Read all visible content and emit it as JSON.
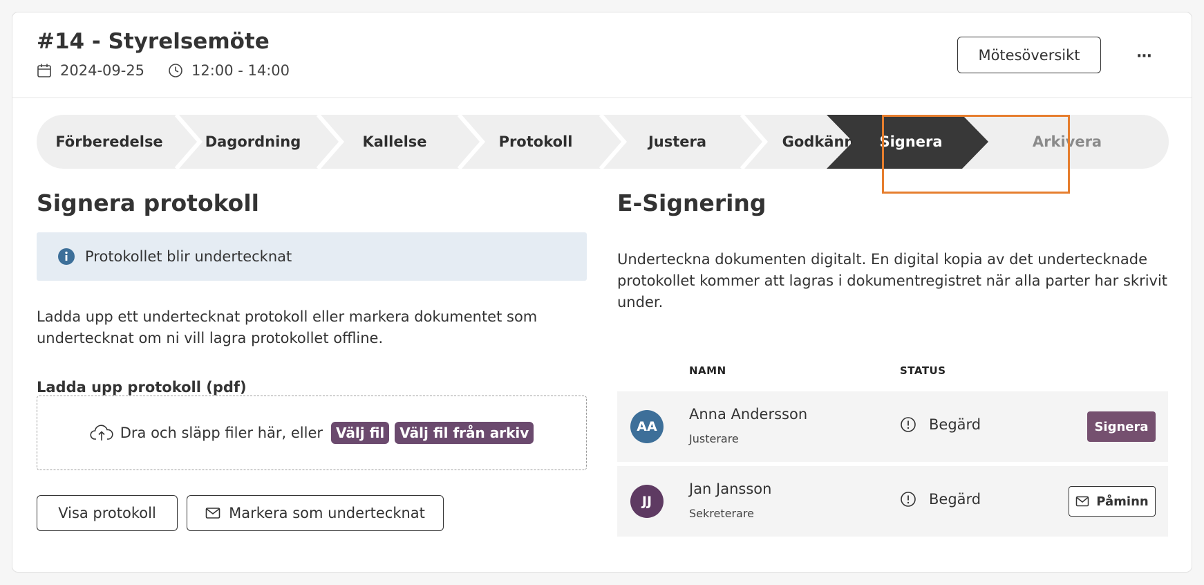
{
  "header": {
    "title": "#14 - Styrelsemöte",
    "date": "2024-09-25",
    "time": "12:00 - 14:00",
    "overview_label": "Mötesöversikt",
    "more_label": "···"
  },
  "stepper": {
    "steps": [
      {
        "label": "Förberedelse",
        "state": "done"
      },
      {
        "label": "Dagordning",
        "state": "done"
      },
      {
        "label": "Kallelse",
        "state": "done"
      },
      {
        "label": "Protokoll",
        "state": "done"
      },
      {
        "label": "Justera",
        "state": "done"
      },
      {
        "label": "Godkänn",
        "state": "done"
      },
      {
        "label": "Signera",
        "state": "active"
      },
      {
        "label": "Arkivera",
        "state": "upcoming"
      }
    ],
    "active_color": "#383838",
    "highlight_color": "#e67e2e"
  },
  "left": {
    "heading": "Signera protokoll",
    "info": "Protokollet blir undertecknat",
    "description": "Ladda upp ett undertecknat protokoll eller markera dokumentet som undertecknat om ni vill lagra protokollet offline.",
    "upload_label": "Ladda upp protokoll (pdf)",
    "dropzone_text": "Dra och släpp filer här, eller",
    "choose_file": "Välj fil",
    "choose_from_archive": "Välj fil från arkiv",
    "view_button": "Visa protokoll",
    "mark_signed_button": "Markera som undertecknat"
  },
  "right": {
    "heading": "E-Signering",
    "description": "Underteckna dokumenten digitalt. En digital kopia av det undertecknade protokollet kommer att lagras i dokumentregistret när alla parter har skrivit under.",
    "col_name": "NAMN",
    "col_status": "STATUS",
    "signers": [
      {
        "initials": "AA",
        "name": "Anna Andersson",
        "role": "Justerare",
        "status": "Begärd",
        "action": "Signera",
        "avatar_color": "#3d6f99"
      },
      {
        "initials": "JJ",
        "name": "Jan Jansson",
        "role": "Sekreterare",
        "status": "Begärd",
        "action": "Påminn",
        "avatar_color": "#5e3a62"
      }
    ]
  },
  "colors": {
    "accent_purple": "#75506f",
    "info_bg": "#e5ecf3"
  }
}
